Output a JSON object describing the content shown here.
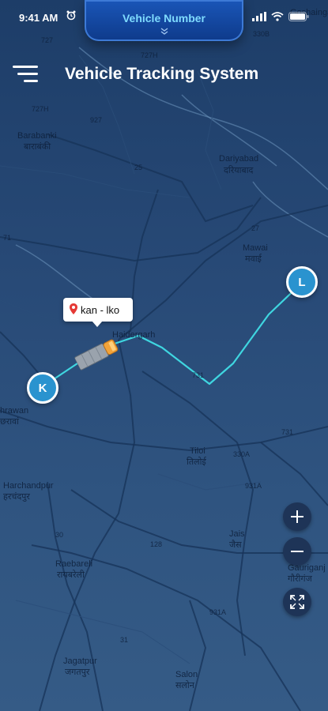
{
  "status_bar": {
    "time": "9:41 AM"
  },
  "notch": {
    "title": "Vehicle Number"
  },
  "header": {
    "title": "Vehicle Tracking System"
  },
  "route": {
    "callout": "kan - lko",
    "start_label": "K",
    "end_label": "L",
    "route_color": "#3fd6e0"
  },
  "map_labels": [
    {
      "id": "barabanki-en",
      "text": "Barabanki"
    },
    {
      "id": "barabanki-hi",
      "text": "बाराबंकी"
    },
    {
      "id": "dariyabad-en",
      "text": "Dariyabad"
    },
    {
      "id": "dariyabad-hi",
      "text": "दरियाबाद"
    },
    {
      "id": "mawai-en",
      "text": "Mawai"
    },
    {
      "id": "mawai-hi",
      "text": "मवाई"
    },
    {
      "id": "haidergarh",
      "text": "Haidergarh"
    },
    {
      "id": "tiloi-en",
      "text": "Tiloi"
    },
    {
      "id": "tiloi-hi",
      "text": "तिलोई"
    },
    {
      "id": "harchandpur-en",
      "text": "Harchandpur"
    },
    {
      "id": "harchandpur-hi",
      "text": "हरचंदपुर"
    },
    {
      "id": "jais-en",
      "text": "Jais"
    },
    {
      "id": "jais-hi",
      "text": "जैस"
    },
    {
      "id": "raebareli-en",
      "text": "Raebareli"
    },
    {
      "id": "raebareli-hi",
      "text": "रायबरेली"
    },
    {
      "id": "jagatpur-en",
      "text": "Jagatpur"
    },
    {
      "id": "jagatpur-hi",
      "text": "जगतपुर"
    },
    {
      "id": "salon-en",
      "text": "Salon"
    },
    {
      "id": "salon-hi",
      "text": "सलोन"
    },
    {
      "id": "gauriganj-en",
      "text": "Gauriganj"
    },
    {
      "id": "gauriganj-hi",
      "text": "गौरीगंज"
    },
    {
      "id": "goshainganj",
      "text": "Goshainganj"
    },
    {
      "id": "bachhrawan",
      "text": "hrawan"
    },
    {
      "id": "bachhrawan-hi",
      "text": "छरावां"
    }
  ],
  "road_numbers": [
    {
      "id": "r727",
      "text": "727"
    },
    {
      "id": "r727h",
      "text": "727H"
    },
    {
      "id": "r927",
      "text": "927"
    },
    {
      "id": "r25",
      "text": "25"
    },
    {
      "id": "r27",
      "text": "27"
    },
    {
      "id": "r731",
      "text": "731"
    },
    {
      "id": "r330a",
      "text": "330A"
    },
    {
      "id": "r931a",
      "text": "931A"
    },
    {
      "id": "r30",
      "text": "30"
    },
    {
      "id": "r128",
      "text": "128"
    },
    {
      "id": "r931a2",
      "text": "931A"
    },
    {
      "id": "r31",
      "text": "31"
    },
    {
      "id": "r330b",
      "text": "330B"
    },
    {
      "id": "r731b",
      "text": "731"
    },
    {
      "id": "r71",
      "text": "71"
    },
    {
      "id": "r727w",
      "text": "727H"
    }
  ],
  "icons": {
    "menu": "menu-icon",
    "zoom_in": "plus-icon",
    "zoom_out": "minus-icon",
    "fullscreen": "expand-icon",
    "pin": "location-pin-icon",
    "truck": "truck-icon"
  },
  "colors": {
    "accent": "#2a93cf",
    "route": "#3fd6e0",
    "notch_text": "#7fdcff",
    "pin": "#e53935"
  }
}
